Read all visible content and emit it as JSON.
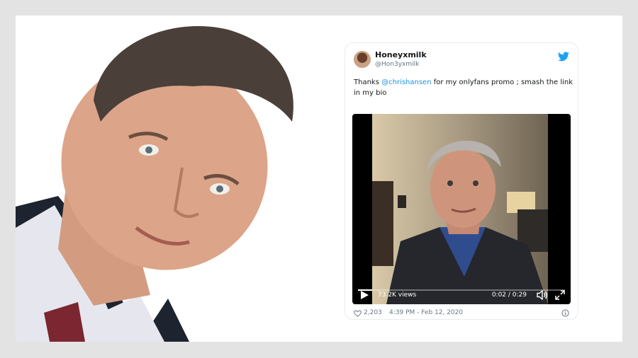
{
  "tweet": {
    "display_name": "Honeyxmilk",
    "handle": "@Hon3yxmilk",
    "text_before": "Thanks ",
    "mention": "@chrishansen",
    "text_after": " for my onlyfans promo ; smash the link in my bio",
    "video": {
      "views": "73.2K views",
      "time": "0:02 / 0:29",
      "progress": 0.07
    },
    "likes": "2,203",
    "timestamp": "4:39 PM - Feb 12, 2020"
  },
  "colors": {
    "link": "#1b95e0",
    "twitter_blue": "#1da1f2",
    "page_bg": "#e3e3e3"
  },
  "icons": {
    "brand": "twitter-bird-icon",
    "play": "play-icon",
    "volume": "volume-icon",
    "fullscreen": "fullscreen-icon",
    "like": "heart-icon",
    "info": "info-icon"
  }
}
